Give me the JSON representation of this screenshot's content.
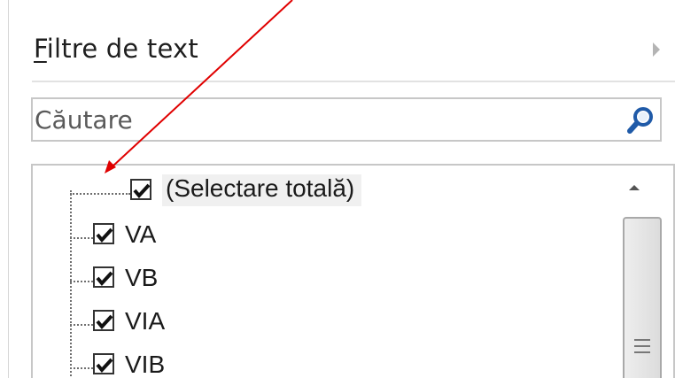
{
  "filter_menu": {
    "label_mnemonic": "F",
    "label_rest": "iltre de text",
    "arrow_icon": "submenu-arrow-icon"
  },
  "search": {
    "placeholder": "Căutare",
    "value": "",
    "icon": "search-icon"
  },
  "items": [
    {
      "label": "(Selectare totală)",
      "checked": true
    },
    {
      "label": "VA",
      "checked": true
    },
    {
      "label": "VB",
      "checked": true
    },
    {
      "label": "VIA",
      "checked": true
    },
    {
      "label": "VIB",
      "checked": true
    }
  ],
  "colors": {
    "annotation_arrow": "#e00000",
    "search_icon": "#1f5aa8"
  }
}
